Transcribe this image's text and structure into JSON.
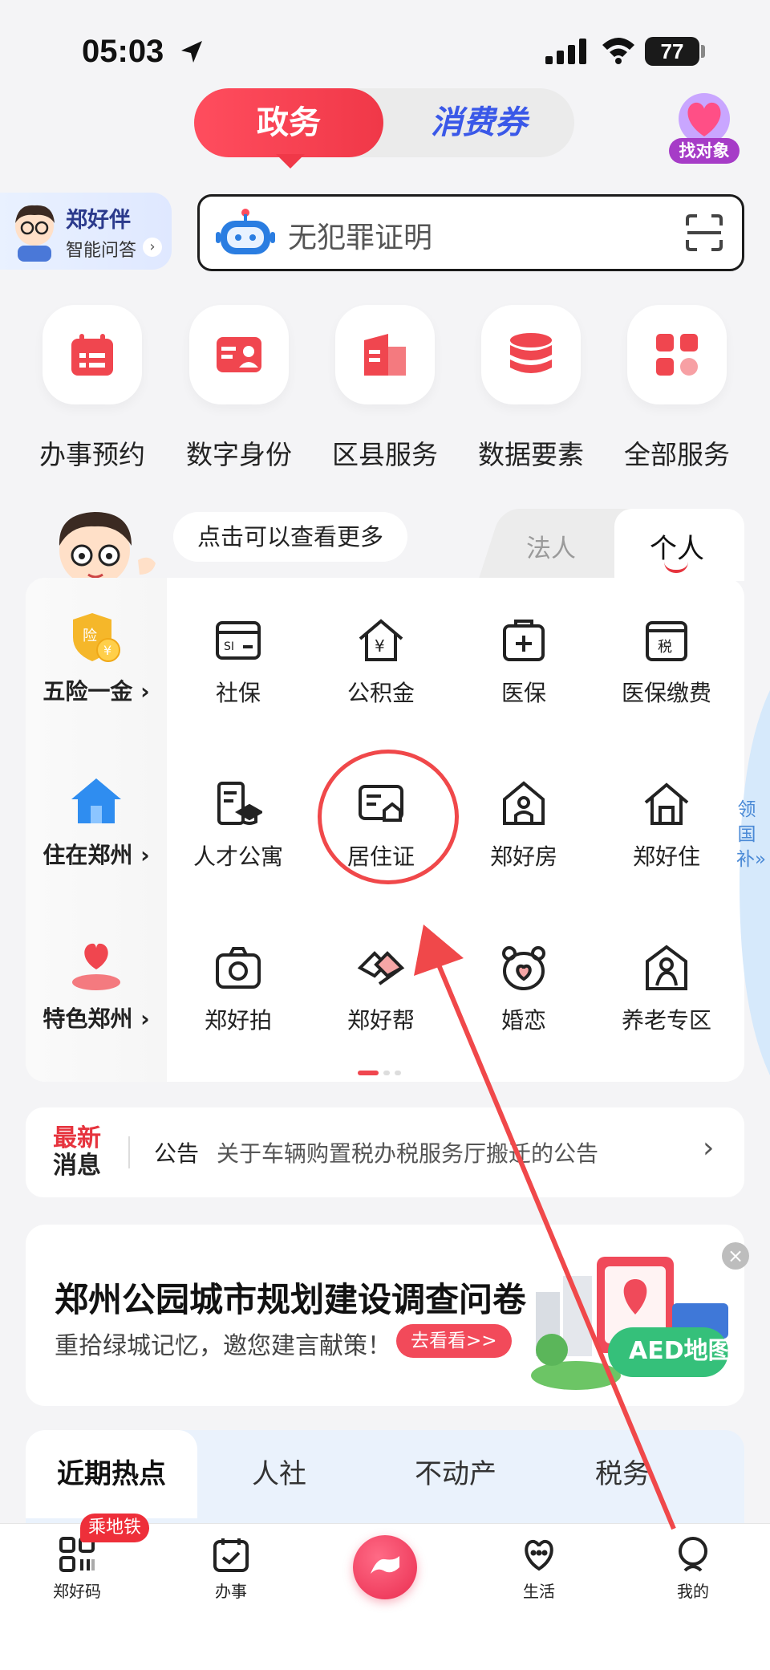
{
  "status_bar": {
    "time": "05:03",
    "battery": "77"
  },
  "top_toggle": {
    "active": "政务",
    "inactive": "消费券"
  },
  "find_match": {
    "label": "找对象"
  },
  "assistant": {
    "name": "郑好伴",
    "subtitle": "智能问答"
  },
  "search": {
    "placeholder": "无犯罪证明"
  },
  "quick_services": [
    {
      "label": "办事预约",
      "icon": "calendar-icon"
    },
    {
      "label": "数字身份",
      "icon": "id-card-icon"
    },
    {
      "label": "区县服务",
      "icon": "building-icon"
    },
    {
      "label": "数据要素",
      "icon": "database-icon"
    },
    {
      "label": "全部服务",
      "icon": "grid-icon"
    }
  ],
  "hint": "点击可以查看更多",
  "segments": {
    "legal": "法人",
    "personal": "个人"
  },
  "categories": [
    {
      "label": "五险一金",
      "icon": "insurance-shield-icon"
    },
    {
      "label": "住在郑州",
      "icon": "house-icon"
    },
    {
      "label": "特色郑州",
      "icon": "heart-location-icon"
    }
  ],
  "services_row1": [
    "社保",
    "公积金",
    "医保",
    "医保缴费"
  ],
  "services_row2": [
    "人才公寓",
    "居住证",
    "郑好房",
    "郑好住"
  ],
  "services_row3": [
    "郑好拍",
    "郑好帮",
    "婚恋",
    "养老专区"
  ],
  "side_tab": "领国补»",
  "news": {
    "tag_line1": "最新",
    "tag_line2": "消息",
    "kind": "公告",
    "text": "关于车辆购置税办税服务厅搬迁的公告"
  },
  "banner": {
    "title": "郑州公园城市规划建设调查问卷",
    "subtitle": "重拾绿城记忆，邀您建言献策！",
    "button": "去看看>>",
    "aed": "AED地图"
  },
  "hot_tabs": [
    "近期热点",
    "人社",
    "不动产",
    "税务"
  ],
  "bottom_nav": [
    {
      "label": "郑好码",
      "badge": "乘地铁"
    },
    {
      "label": "办事"
    },
    {
      "label": "生活"
    },
    {
      "label": "我的"
    }
  ],
  "colors": {
    "accent": "#f03848",
    "blue": "#3a58e8",
    "annotation": "#f0484a"
  }
}
